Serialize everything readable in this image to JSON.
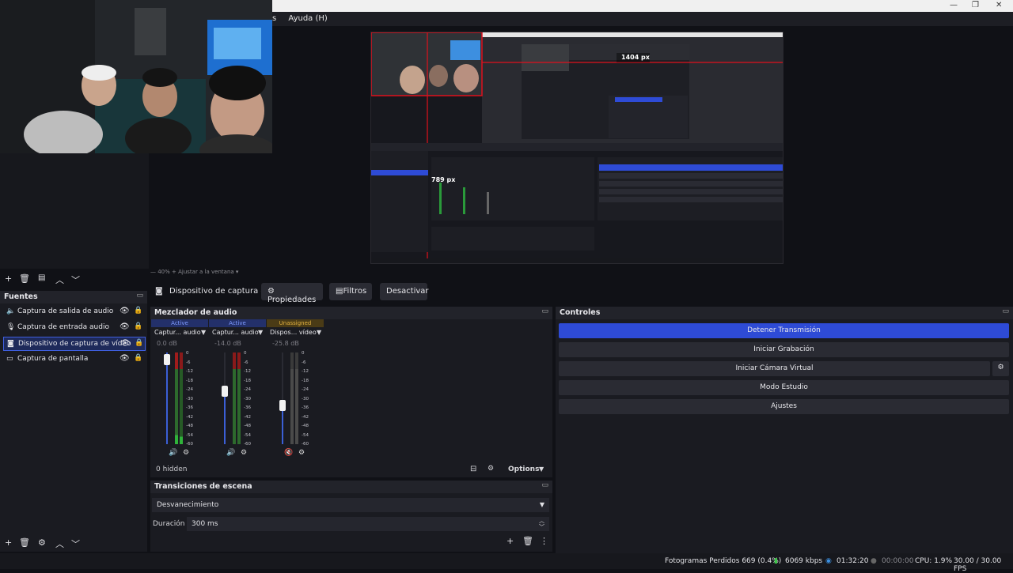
{
  "window": {
    "menu": [
      "s",
      "Ayuda (H)"
    ],
    "controls": [
      "—",
      "❐",
      "✕"
    ]
  },
  "preview": {
    "zoom_text": "—     40%     +     Ajustar a la ventana   ▾",
    "overlay": {
      "width_label": "1404 px",
      "height_label": "789 px"
    }
  },
  "source_toolbar": {
    "selected_source": "Dispositivo de captura de v",
    "properties_label": "Propiedades",
    "filters_label": "Filtros",
    "deactivate_label": "Desactivar"
  },
  "sources": {
    "title": "Fuentes",
    "items": [
      {
        "label": "Captura de salida de audio",
        "icon": "speaker-icon"
      },
      {
        "label": "Captura de entrada audio",
        "icon": "microphone-icon"
      },
      {
        "label": "Dispositivo de captura de vídeo",
        "icon": "camera-icon",
        "selected": true
      },
      {
        "label": "Captura de pantalla",
        "icon": "monitor-icon"
      }
    ]
  },
  "mixer": {
    "title": "Mezclador de audio",
    "channels": [
      {
        "status": "Active",
        "name": "Captur... audio",
        "db": "0.0 dB",
        "fader_level": 0.9,
        "muted": false
      },
      {
        "status": "Active",
        "name": "Captur... audio",
        "db": "-14.0 dB",
        "fader_level": 0.55,
        "muted": false
      },
      {
        "status": "Unassigned",
        "name": "Dispos... vídeo",
        "db": "-25.8 dB",
        "fader_level": 0.38,
        "muted": true
      }
    ],
    "scale": [
      "0",
      "-6",
      "-12",
      "-18",
      "-24",
      "-30",
      "-36",
      "-42",
      "-48",
      "-54",
      "-60"
    ],
    "hidden_count": "0 hidden",
    "options_label": "Options"
  },
  "controls": {
    "title": "Controles",
    "buttons": [
      "Detener Transmisión",
      "Iniciar Grabación",
      "Iniciar Cámara Virtual",
      "Modo Estudio",
      "Ajustes"
    ]
  },
  "transitions": {
    "title": "Transiciones de escena",
    "selected": "Desvanecimiento",
    "duration_label": "Duración",
    "duration_value": "300 ms"
  },
  "status": {
    "dropped_frames": "Fotogramas Perdidos 669 (0.4%)",
    "bitrate": "6069 kbps",
    "stream_time": "01:32:20",
    "record_time": "00:00:00",
    "cpu": "CPU: 1.9%",
    "fps": "30.00 / 30.00 FPS"
  },
  "colors": {
    "accent": "#2e4bd6",
    "selection_outline": "#e0101c",
    "active_status": "#3b5fd6",
    "unassigned_status": "#c89a2a"
  }
}
